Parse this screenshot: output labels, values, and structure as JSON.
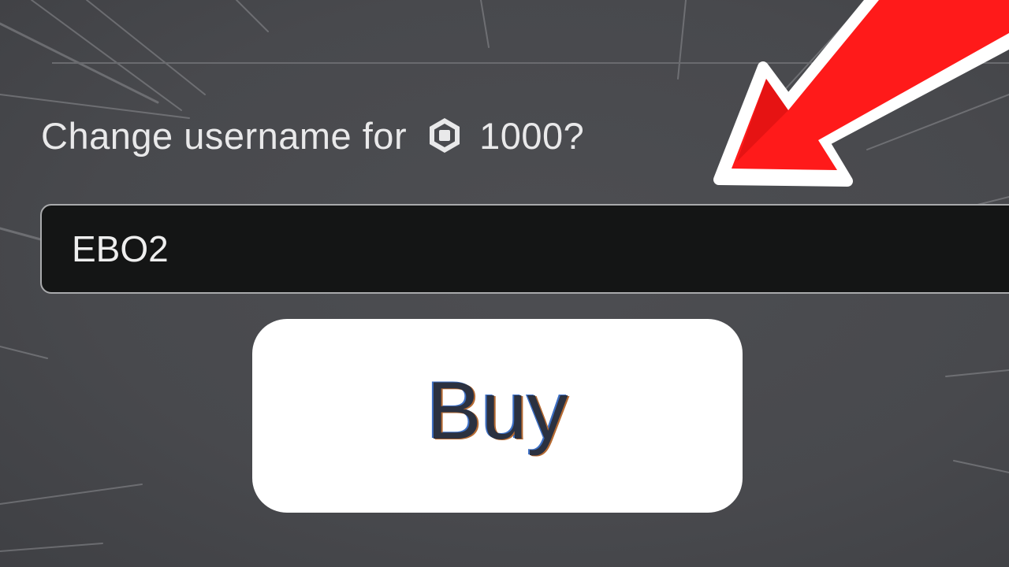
{
  "dialog": {
    "prompt_prefix": "Change username for",
    "price": "1000?",
    "currency_icon": "robux-icon",
    "username_value": "EBO2",
    "buy_label": "Buy"
  },
  "overlay": {
    "arrow_icon": "red-arrow-icon",
    "arrow_color": "#ff1a1a",
    "arrow_outline": "#ffffff"
  }
}
